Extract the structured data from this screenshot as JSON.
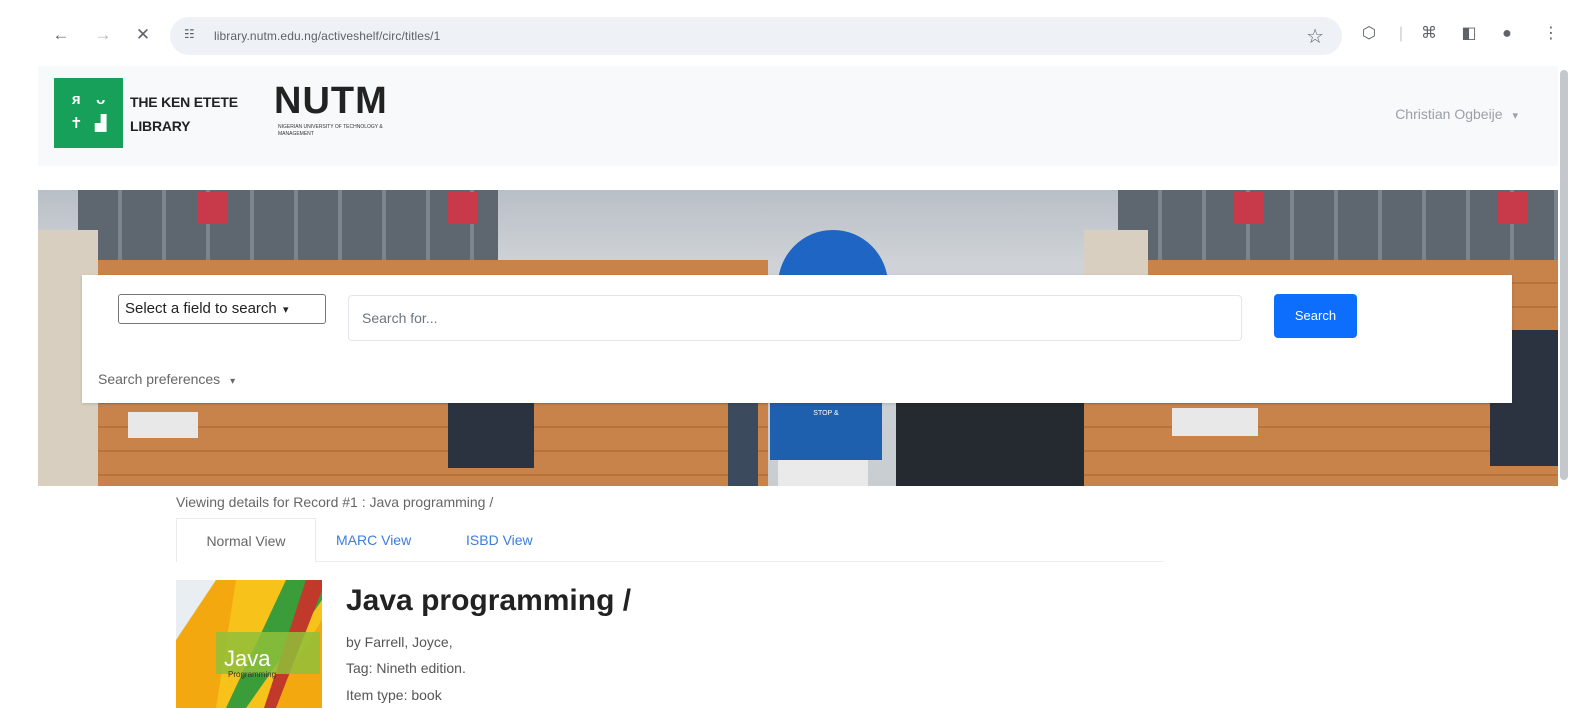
{
  "browser": {
    "back_icon": "←",
    "forward_icon": "→",
    "stop_icon": "✕",
    "site_info_icon": "☷",
    "url": "library.nutm.edu.ng/activeshelf/circ/titles/1",
    "bookmark_icon": "☆"
  },
  "header": {
    "logo_glyphs": [
      "ᴙ",
      "ᴗ",
      "✝",
      "▟"
    ],
    "library_line1": "THE KEN ETETE",
    "library_line2": "LIBRARY",
    "brand": "NUTM",
    "brand_sub": "NIGERIAN UNIVERSITY OF TECHNOLOGY & MANAGEMENT",
    "user_name": "Christian Ogbeije",
    "user_caret": "▾"
  },
  "search": {
    "field_select_label": "Select a field to search",
    "field_select_caret": "▾",
    "input_placeholder": "Search for...",
    "button_label": "Search",
    "preferences_label": "Search preferences",
    "preferences_caret": "▾"
  },
  "hero": {
    "sign_text": "STOP &"
  },
  "record": {
    "breadcrumb": "Viewing details for Record #1 : Java programming /",
    "tabs": [
      {
        "label": "Normal View",
        "active": true
      },
      {
        "label": "MARC View",
        "active": false
      },
      {
        "label": "ISBD View",
        "active": false
      }
    ],
    "cover_text": "Java",
    "cover_subtext": "Programming",
    "title": "Java programming /",
    "author_line": "by Farrell, Joyce,",
    "tag_line": "Tag: Nineth edition.",
    "item_type_line": "Item type: book"
  },
  "colors": {
    "brand_green": "#16a05a",
    "search_button": "#0d6efd",
    "tab_link": "#3b7ddd"
  }
}
